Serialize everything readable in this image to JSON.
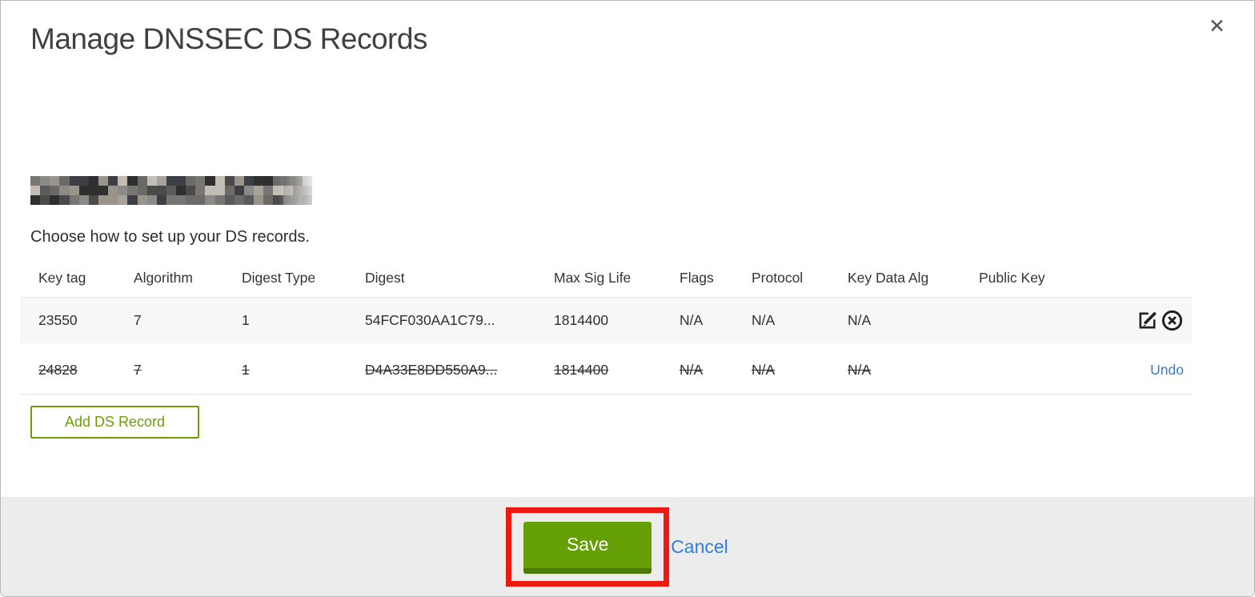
{
  "modal": {
    "title": "Manage DNSSEC DS Records",
    "close_icon": "✕"
  },
  "intro": {
    "instruction": "Choose how to set up your DS records."
  },
  "redacted_domain": {
    "note": "domain name pixelated/redacted",
    "cols": 29,
    "rows": 3,
    "seed": 20231,
    "palette": [
      "#2f2f2f",
      "#4a4a48",
      "#6b6a68",
      "#8c8a86",
      "#a7a29a",
      "#3d3f44",
      "#9b948a",
      "#5a5a5a",
      "#c2beb6",
      "#777672"
    ]
  },
  "table": {
    "headers": [
      "Key tag",
      "Algorithm",
      "Digest Type",
      "Digest",
      "Max Sig Life",
      "Flags",
      "Protocol",
      "Key Data Alg",
      "Public Key"
    ],
    "rows": [
      {
        "state": "normal",
        "cells": [
          "23550",
          "7",
          "1",
          "54FCF030AA1C79...",
          "1814400",
          "N/A",
          "N/A",
          "N/A",
          ""
        ],
        "actions": [
          "edit-icon",
          "delete-icon"
        ]
      },
      {
        "state": "deleted",
        "cells": [
          "24828",
          "7",
          "1",
          "D4A33E8DD550A9...",
          "1814400",
          "N/A",
          "N/A",
          "N/A",
          ""
        ],
        "action_label": "Undo"
      }
    ]
  },
  "buttons": {
    "add_ds_record": "Add DS Record",
    "save": "Save",
    "cancel": "Cancel"
  },
  "colors": {
    "green": "#64a004",
    "green_dark": "#4b7a05",
    "green_outline": "#6b9e08",
    "link_blue": "#2d7de0",
    "annotation_red": "#ee1a11",
    "row_alt_bg": "#f7f7f7",
    "footer_bg": "#ececec"
  }
}
